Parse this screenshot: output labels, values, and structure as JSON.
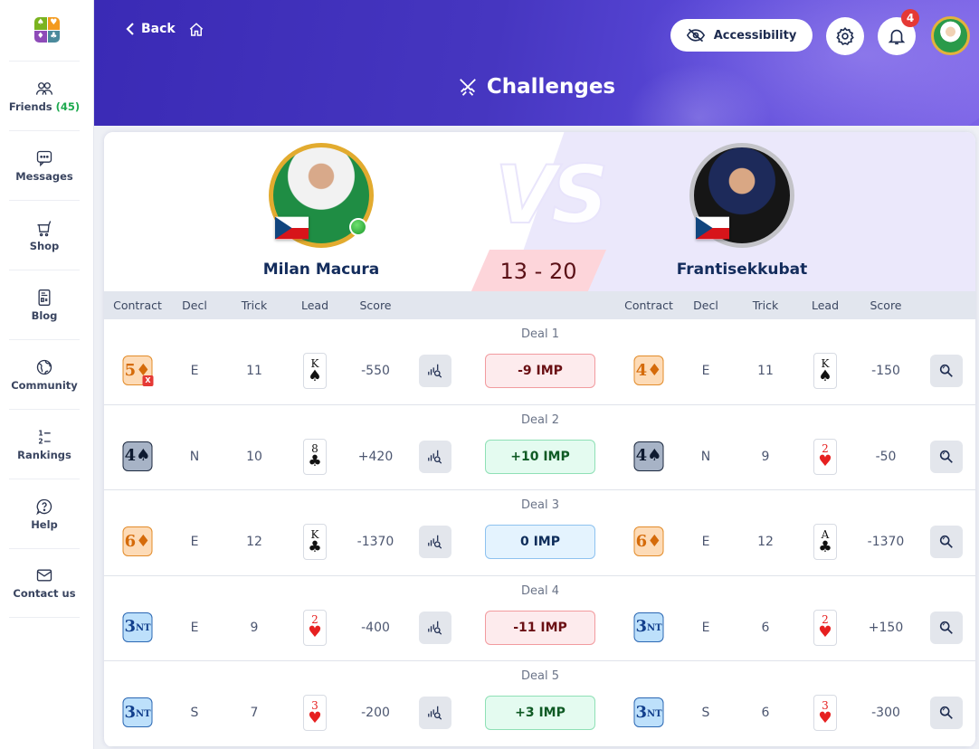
{
  "sidebar": {
    "logo_suits": [
      "♠",
      "♥",
      "♦",
      "♣"
    ],
    "items": [
      {
        "label": "Friends",
        "count": "(45)",
        "icon": "friends-icon"
      },
      {
        "label": "Messages",
        "icon": "messages-icon"
      },
      {
        "label": "Shop",
        "icon": "cart-icon"
      },
      {
        "label": "Blog",
        "icon": "blog-icon"
      },
      {
        "label": "Community",
        "icon": "globe-icon"
      },
      {
        "label": "Rankings",
        "icon": "rankings-icon"
      },
      {
        "label": "Help",
        "icon": "help-icon"
      },
      {
        "label": "Contact us",
        "icon": "mail-icon"
      }
    ]
  },
  "header": {
    "back_label": "Back",
    "title": "Challenges",
    "accessibility_label": "Accessibility",
    "notification_count": "4"
  },
  "match": {
    "vs_label": "VS",
    "score": "13 - 20",
    "player_left": {
      "name": "Milan Macura",
      "country": "Czech Republic",
      "online": true
    },
    "player_right": {
      "name": "Frantisekkubat",
      "country": "Czech Republic",
      "online": false
    }
  },
  "table": {
    "left_headers": [
      "Contract",
      "Decl",
      "Trick",
      "Lead",
      "Score"
    ],
    "right_headers": [
      "Contract",
      "Decl",
      "Trick",
      "Lead",
      "Score"
    ],
    "deals": [
      {
        "label": "Deal 1",
        "imp": "-9 IMP",
        "imp_type": "neg",
        "left": {
          "level": "5",
          "strain": "♦",
          "kind": "diamond",
          "doubled": "X",
          "decl": "E",
          "tricks": "11",
          "lead_rank": "K",
          "lead_suit": "♠",
          "lead_color": "black",
          "score": "-550"
        },
        "right": {
          "level": "4",
          "strain": "♦",
          "kind": "diamond",
          "doubled": "",
          "decl": "E",
          "tricks": "11",
          "lead_rank": "K",
          "lead_suit": "♠",
          "lead_color": "black",
          "score": "-150"
        }
      },
      {
        "label": "Deal 2",
        "imp": "+10 IMP",
        "imp_type": "pos",
        "left": {
          "level": "4",
          "strain": "♠",
          "kind": "spade",
          "doubled": "",
          "decl": "N",
          "tricks": "10",
          "lead_rank": "8",
          "lead_suit": "♣",
          "lead_color": "black",
          "score": "+420"
        },
        "right": {
          "level": "4",
          "strain": "♠",
          "kind": "spade",
          "doubled": "",
          "decl": "N",
          "tricks": "9",
          "lead_rank": "2",
          "lead_suit": "♥",
          "lead_color": "red",
          "score": "-50"
        }
      },
      {
        "label": "Deal 3",
        "imp": "0 IMP",
        "imp_type": "zero",
        "left": {
          "level": "6",
          "strain": "♦",
          "kind": "diamond",
          "doubled": "",
          "decl": "E",
          "tricks": "12",
          "lead_rank": "K",
          "lead_suit": "♣",
          "lead_color": "black",
          "score": "-1370"
        },
        "right": {
          "level": "6",
          "strain": "♦",
          "kind": "diamond",
          "doubled": "",
          "decl": "E",
          "tricks": "12",
          "lead_rank": "A",
          "lead_suit": "♣",
          "lead_color": "black",
          "score": "-1370"
        }
      },
      {
        "label": "Deal 4",
        "imp": "-11 IMP",
        "imp_type": "neg",
        "left": {
          "level": "3",
          "strain": "NT",
          "kind": "nt",
          "doubled": "",
          "decl": "E",
          "tricks": "9",
          "lead_rank": "2",
          "lead_suit": "♥",
          "lead_color": "red",
          "score": "-400"
        },
        "right": {
          "level": "3",
          "strain": "NT",
          "kind": "nt",
          "doubled": "",
          "decl": "E",
          "tricks": "6",
          "lead_rank": "2",
          "lead_suit": "♥",
          "lead_color": "red",
          "score": "+150"
        }
      },
      {
        "label": "Deal 5",
        "imp": "+3 IMP",
        "imp_type": "pos",
        "left": {
          "level": "3",
          "strain": "NT",
          "kind": "nt",
          "doubled": "",
          "decl": "S",
          "tricks": "7",
          "lead_rank": "3",
          "lead_suit": "♥",
          "lead_color": "red",
          "score": "-200"
        },
        "right": {
          "level": "3",
          "strain": "NT",
          "kind": "nt",
          "doubled": "",
          "decl": "S",
          "tricks": "6",
          "lead_rank": "3",
          "lead_suit": "♥",
          "lead_color": "red",
          "score": "-300"
        }
      }
    ]
  },
  "colors": {
    "header_primary": "#3a2ab5",
    "imp_negative": "#fdebed",
    "imp_positive": "#e4fbf0",
    "imp_zero": "#e4f3fe",
    "friends_count": "#1ea94f",
    "score_box": "#fdd5da"
  }
}
